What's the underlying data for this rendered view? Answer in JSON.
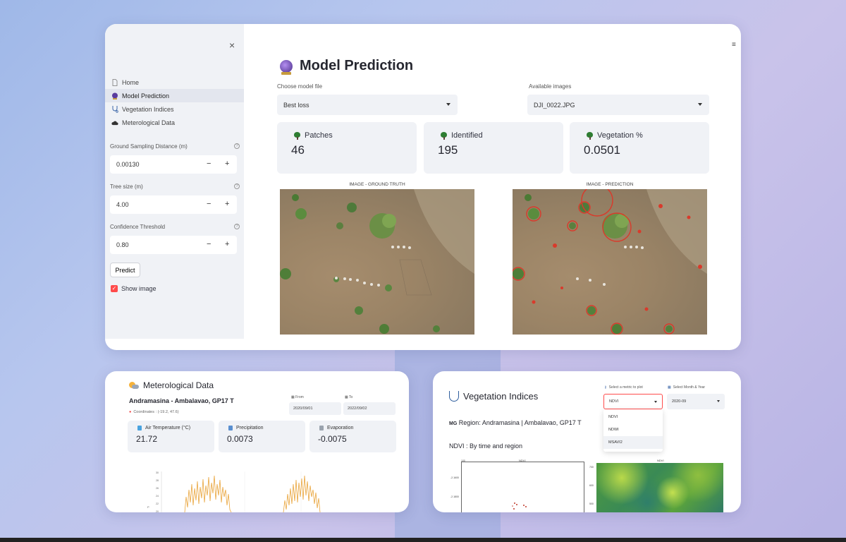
{
  "main": {
    "sidebar": {
      "close_glyph": "×",
      "nav": [
        {
          "label": "Home",
          "icon": "document-icon"
        },
        {
          "label": "Model Prediction",
          "icon": "crystal-ball-icon"
        },
        {
          "label": "Vegetation Indices",
          "icon": "stethoscope-icon"
        },
        {
          "label": "Meterological Data",
          "icon": "cloud-icon"
        }
      ],
      "gsd": {
        "label": "Ground Sampling Distance (m)",
        "value": "0.00130"
      },
      "tree_size": {
        "label": "Tree size (m)",
        "value": "4.00"
      },
      "confidence": {
        "label": "Confidence Threshold",
        "value": "0.80"
      },
      "minus": "−",
      "plus": "+",
      "help": "?",
      "predict_label": "Predict",
      "show_image_label": "Show image",
      "check": "✓"
    },
    "menu_glyph": "≡",
    "title": "Model Prediction",
    "model_select": {
      "label": "Choose model file",
      "value": "Best loss"
    },
    "image_select": {
      "label": "Available images",
      "value": "DJI_0022.JPG"
    },
    "metrics": [
      {
        "label": "Patches",
        "value": "46"
      },
      {
        "label": "Identified",
        "value": "195"
      },
      {
        "label": "Vegetation %",
        "value": "0.0501"
      }
    ],
    "image_titles": {
      "ground_truth": "IMAGE - GROUND TRUTH",
      "prediction": "IMAGE - PREDICTION"
    }
  },
  "met": {
    "title": "Meterological Data",
    "location": "Andramasina - Ambalavao, GP17 T",
    "coordinates": "Coordinates : (-19.2, 47.6)",
    "from_label": "From",
    "from_value": "2020/09/01",
    "to_label": "To",
    "to_value": "2022/09/02",
    "metrics": [
      {
        "label": "Air Temperature (°C)",
        "value": "21.72"
      },
      {
        "label": "Precipitation",
        "value": "0.0073"
      },
      {
        "label": "Evaporation",
        "value": "-0.0075"
      }
    ],
    "chart_ticks": [
      "30",
      "28",
      "26",
      "24",
      "22",
      "20"
    ],
    "chart_ylabel": "P"
  },
  "veg": {
    "title": "Vegetation Indices",
    "region_prefix": "MG",
    "region": "Region: Andramasina | Ambalavao, GP17 T",
    "ndvi_heading": "NDVI : By time and region",
    "metric_label": "Select a metric to plot",
    "metric_value": "NDVI",
    "month_label": "Select Month & Year",
    "month_value": "2020-09",
    "options": [
      "NDVI",
      "NDWI",
      "MSAVI2"
    ],
    "plot_title_left": "NDVI",
    "plot_title_right": "NDVI",
    "left_axis": [
      "100",
      "-2.1600",
      "-2.1800"
    ],
    "right_axis": [
      "700",
      "600",
      "500"
    ]
  }
}
